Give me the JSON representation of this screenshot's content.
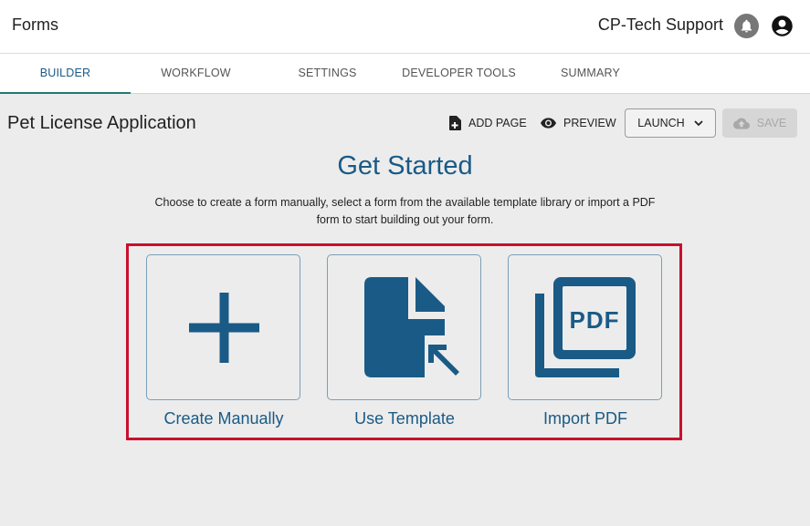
{
  "header": {
    "app_title": "Forms",
    "org_name": "CP-Tech Support",
    "bell_icon": "bell-icon",
    "user_icon": "account-circle-icon"
  },
  "tabs": [
    {
      "label": "BUILDER",
      "active": true
    },
    {
      "label": "WORKFLOW",
      "active": false
    },
    {
      "label": "SETTINGS",
      "active": false
    },
    {
      "label": "DEVELOPER TOOLS",
      "active": false
    },
    {
      "label": "SUMMARY",
      "active": false
    }
  ],
  "page": {
    "title": "Pet License Application"
  },
  "toolbar": {
    "add_page_label": "ADD PAGE",
    "preview_label": "PREVIEW",
    "launch_label": "LAUNCH",
    "save_label": "SAVE",
    "save_disabled": true
  },
  "get_started": {
    "heading": "Get Started",
    "description": "Choose to create a form manually, select a form from the available template library or import a PDF form to start building out your form."
  },
  "options": [
    {
      "label": "Create Manually",
      "icon": "plus-icon"
    },
    {
      "label": "Use Template",
      "icon": "template-file-icon"
    },
    {
      "label": "Import PDF",
      "icon": "pdf-icon"
    }
  ],
  "colors": {
    "accent": "#1a5a86",
    "tab_underline": "#1f7a74",
    "highlight": "#c8102e"
  }
}
